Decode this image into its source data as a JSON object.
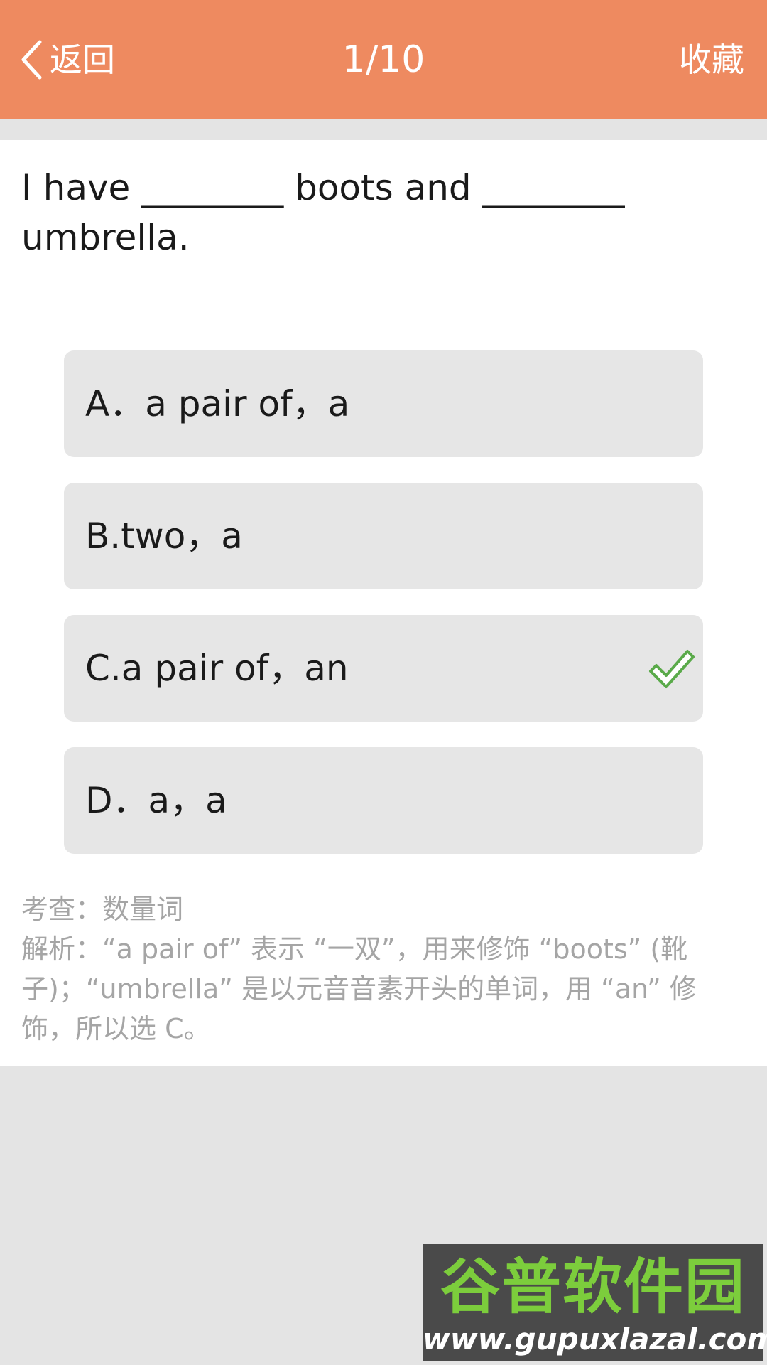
{
  "header": {
    "back_label": "返回",
    "progress": "1/10",
    "favorite_label": "收藏",
    "bar_color": "#ee8a60"
  },
  "question": {
    "line1": "I have ________ boots and ________",
    "line2": "umbrella."
  },
  "options": [
    {
      "label": "A．a pair of，a",
      "correct": false
    },
    {
      "label": "B.two，a",
      "correct": false
    },
    {
      "label": "C.a pair of，an",
      "correct": true
    },
    {
      "label": "D．a，a",
      "correct": false
    }
  ],
  "explanation": {
    "topic": "考查：数量词",
    "line1": "解析：“a pair of” 表示 “一双”，用来修饰 “boots” (靴",
    "line2": "子)；“umbrella” 是以元音音素开头的单词，用 “an” 修",
    "line3": "饰，所以选 C。"
  },
  "watermark": {
    "title": "谷普软件园",
    "url": "www.gupuxlazal.com"
  },
  "icons": {
    "back": "chevron-left-icon",
    "correct": "checkmark-icon"
  },
  "colors": {
    "accent": "#ee8a60",
    "check": "#5aaa4a"
  }
}
